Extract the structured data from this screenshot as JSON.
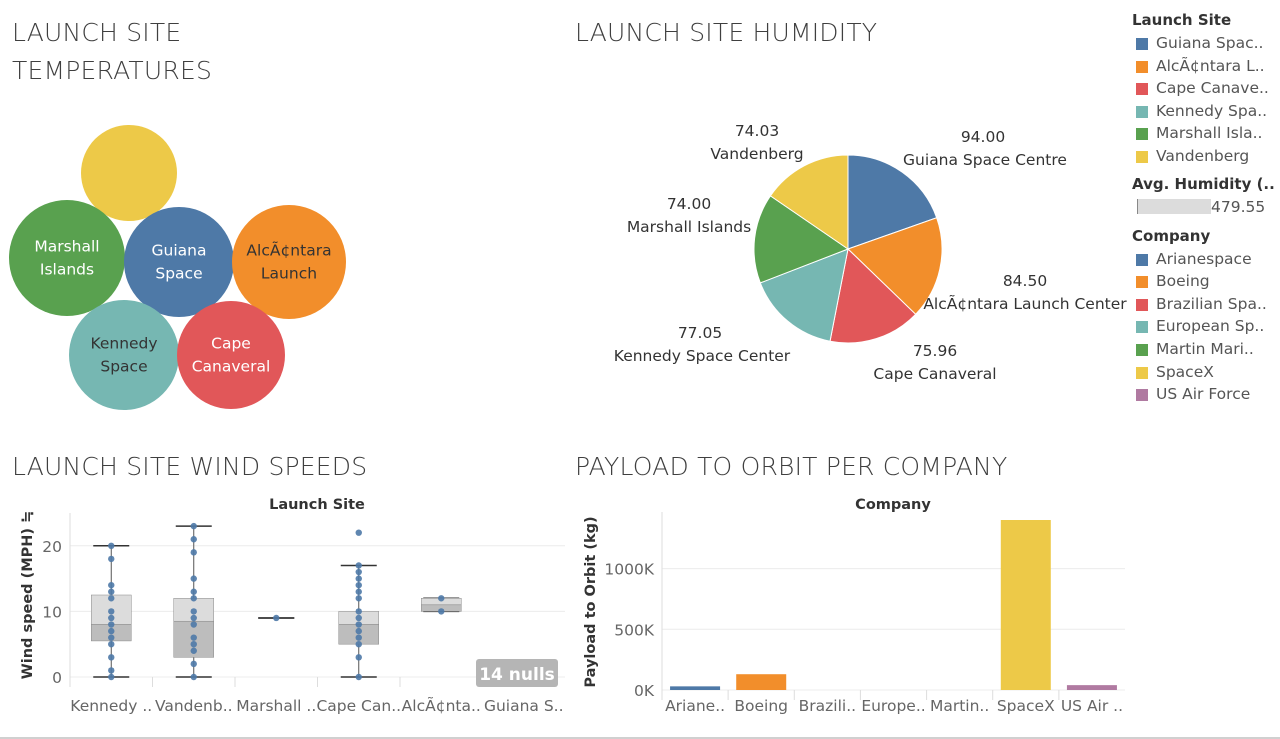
{
  "titles": {
    "temperatures_line1": "LAUNCH SITE",
    "temperatures_line2": "TEMPERATURES",
    "humidity": "LAUNCH SITE HUMIDITY",
    "wind": "LAUNCH SITE WIND SPEEDS",
    "payload": "PAYLOAD TO ORBIT PER COMPANY"
  },
  "colors": {
    "blue": "#4E79A7",
    "orange": "#F28E2B",
    "red": "#E15759",
    "teal": "#76B7B2",
    "green": "#59A14F",
    "yellow": "#EDC948",
    "purple": "#B07AA1"
  },
  "legend": {
    "launch_site_title": "Launch Site",
    "launch_sites": [
      {
        "label": "Guiana Spac..",
        "color": "#4E79A7"
      },
      {
        "label": "AlcÃ¢ntara L..",
        "color": "#F28E2B"
      },
      {
        "label": "Cape Canave..",
        "color": "#E15759"
      },
      {
        "label": "Kennedy Spa..",
        "color": "#76B7B2"
      },
      {
        "label": "Marshall Isla..",
        "color": "#59A14F"
      },
      {
        "label": "Vandenberg",
        "color": "#EDC948"
      }
    ],
    "size_title": "Avg. Humidity (..",
    "size_value": "479.55",
    "company_title": "Company",
    "companies": [
      {
        "label": "Arianespace",
        "color": "#4E79A7"
      },
      {
        "label": "Boeing",
        "color": "#F28E2B"
      },
      {
        "label": "Brazilian Spa..",
        "color": "#E15759"
      },
      {
        "label": "European Sp..",
        "color": "#76B7B2"
      },
      {
        "label": "Martin Mari..",
        "color": "#59A14F"
      },
      {
        "label": "SpaceX",
        "color": "#EDC948"
      },
      {
        "label": "US Air Force",
        "color": "#B07AA1"
      }
    ]
  },
  "chart_data": [
    {
      "type": "bubble",
      "title": "LAUNCH SITE TEMPERATURES",
      "bubbles": [
        {
          "label_lines": [],
          "color": "#EDC948"
        },
        {
          "label_lines": [
            "Marshall",
            "Islands"
          ],
          "color": "#59A14F"
        },
        {
          "label_lines": [
            "Guiana",
            "Space"
          ],
          "color": "#4E79A7"
        },
        {
          "label_lines": [
            "AlcÃ¢ntara",
            "Launch"
          ],
          "color": "#F28E2B"
        },
        {
          "label_lines": [
            "Kennedy",
            "Space"
          ],
          "color": "#76B7B2"
        },
        {
          "label_lines": [
            "Cape",
            "Canaveral"
          ],
          "color": "#E15759"
        }
      ]
    },
    {
      "type": "pie",
      "title": "LAUNCH SITE HUMIDITY",
      "slices": [
        {
          "label": "Guiana Space Centre",
          "value": 94.0,
          "value_label": "94.00",
          "color": "#4E79A7"
        },
        {
          "label": "AlcÃ¢ntara Launch Center",
          "value": 84.5,
          "value_label": "84.50",
          "color": "#F28E2B"
        },
        {
          "label": "Cape Canaveral",
          "value": 75.96,
          "value_label": "75.96",
          "color": "#E15759"
        },
        {
          "label": "Kennedy Space Center",
          "value": 77.05,
          "value_label": "77.05",
          "color": "#76B7B2"
        },
        {
          "label": "Marshall Islands",
          "value": 74.0,
          "value_label": "74.00",
          "color": "#59A14F"
        },
        {
          "label": "Vandenberg",
          "value": 74.03,
          "value_label": "74.03",
          "color": "#EDC948"
        }
      ]
    },
    {
      "type": "boxplot",
      "title": "LAUNCH SITE WIND SPEEDS",
      "header": "Launch Site",
      "ylabel": "Wind speed (MPH) ≒",
      "ylim": [
        0,
        25
      ],
      "yticks": [
        0,
        10,
        20
      ],
      "categories": [
        "Kennedy ..",
        "Vandenb..",
        "Marshall ..",
        "Cape Can..",
        "AlcÃ¢nta..",
        "Guiana S.."
      ],
      "boxes": [
        {
          "min": 0,
          "q1": 5.5,
          "median": 8,
          "q3": 12.5,
          "max": 20,
          "points": [
            0,
            1,
            3,
            5,
            6,
            7,
            8,
            9,
            10,
            12,
            13,
            14,
            18,
            20
          ]
        },
        {
          "min": 0,
          "q1": 3,
          "median": 8.5,
          "q3": 12,
          "max": 23,
          "points": [
            0,
            2,
            4,
            5,
            6,
            8,
            9,
            10,
            12,
            13,
            15,
            19,
            21,
            23
          ]
        },
        {
          "min": 9,
          "q1": 9,
          "median": 9,
          "q3": 9,
          "max": 9,
          "points": [
            9
          ]
        },
        {
          "min": 0,
          "q1": 5,
          "median": 8,
          "q3": 10,
          "max": 17,
          "points": [
            0,
            3,
            5,
            6,
            7,
            8,
            9,
            10,
            12,
            13,
            14,
            15,
            16,
            17,
            22
          ]
        },
        {
          "min": 10,
          "q1": 10,
          "median": 11,
          "q3": 12,
          "max": 12,
          "points": [
            10,
            12
          ]
        },
        null
      ],
      "nulls_label": "14 nulls"
    },
    {
      "type": "bar",
      "title": "PAYLOAD TO ORBIT PER COMPANY",
      "header": "Company",
      "ylabel": "Payload to Orbit (kg)",
      "ylim": [
        0,
        1400000
      ],
      "yticks": [
        0,
        500000,
        1000000
      ],
      "ytick_labels": [
        "0K",
        "500K",
        "1000K"
      ],
      "categories": [
        "Ariane..",
        "Boeing",
        "Brazili..",
        "Europe..",
        "Martin..",
        "SpaceX",
        "US Air .."
      ],
      "values": [
        30000,
        130000,
        0,
        0,
        0,
        1400000,
        40000
      ],
      "colors": [
        "#4E79A7",
        "#F28E2B",
        "#E15759",
        "#76B7B2",
        "#59A14F",
        "#EDC948",
        "#B07AA1"
      ]
    }
  ]
}
